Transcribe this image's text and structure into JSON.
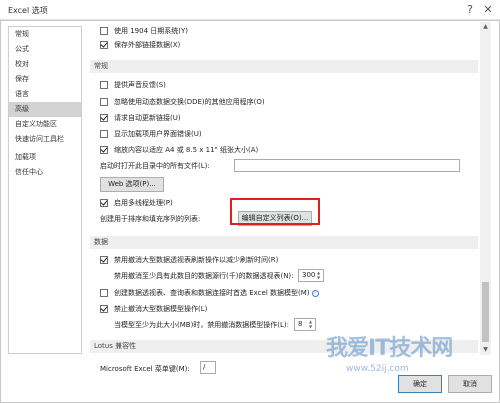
{
  "window": {
    "title": "Excel 选项",
    "help_glyph": "?",
    "close_glyph": "✕"
  },
  "sidebar": {
    "items": [
      {
        "label": "常规"
      },
      {
        "label": "公式"
      },
      {
        "label": "校对"
      },
      {
        "label": "保存"
      },
      {
        "label": "语言"
      },
      {
        "label": "高级",
        "active": true
      },
      {
        "label": "自定义功能区"
      },
      {
        "label": "快速访问工具栏"
      },
      {
        "label": "加载项"
      },
      {
        "label": "信任中心"
      }
    ]
  },
  "top_options": [
    {
      "label": "使用 1904 日期系统(Y)",
      "checked": false
    },
    {
      "label": "保存外部链接数据(X)",
      "checked": true
    }
  ],
  "general": {
    "header": "常规",
    "options": [
      {
        "label": "提供声音反馈(S)",
        "checked": false
      },
      {
        "label": "忽略使用动态数据交换(DDE)的其他应用程序(O)",
        "checked": false
      },
      {
        "label": "请求自动更新链接(U)",
        "checked": true
      },
      {
        "label": "显示加载项用户界面错误(U)",
        "checked": false
      },
      {
        "label": "缩放内容以适应 A4 或 8.5 x 11\" 纸张大小(A)",
        "checked": true
      }
    ],
    "startup_label": "启动时打开此目录中的所有文件(L):",
    "startup_value": "",
    "web_button": "Web 选项(P)...",
    "multithread": {
      "label": "启用多线程处理(P)",
      "checked": true
    },
    "custom_list_label": "创建用于排序和填充序列的列表:",
    "custom_list_button": "编辑自定义列表(O)..."
  },
  "data": {
    "header": "数据",
    "disable_undo_pivot": {
      "label": "禁用撤消大型数据透视表刷新操作以减少刷新时间(R)",
      "checked": true
    },
    "pivot_rows_label": "禁用撤消至少具有此数目的数据源行(千)的数据透视表(N):",
    "pivot_rows_value": "300",
    "default_model": {
      "label": "创建数据透视表、查询表和数据连接时首选 Excel 数据模型(M)",
      "checked": false
    },
    "info_glyph": "i",
    "disable_undo_model": {
      "label": "禁止撤消大型数据模型操作(L)",
      "checked": true
    },
    "model_size_label": "当模型至少为此大小(MB)时，禁用撤消数据模型操作(L):",
    "model_size_value": "8"
  },
  "lotus": {
    "header": "Lotus 兼容性",
    "menu_key_label": "Microsoft Excel 菜单键(M):",
    "menu_key_value": "/"
  },
  "footer": {
    "ok": "确定",
    "cancel": "取消"
  },
  "watermark": {
    "text": "我爱IT技术网",
    "url": "www.52ij.com"
  },
  "colors": {
    "highlight": "#e02020",
    "active_sidebar": "#d3d3d3"
  }
}
